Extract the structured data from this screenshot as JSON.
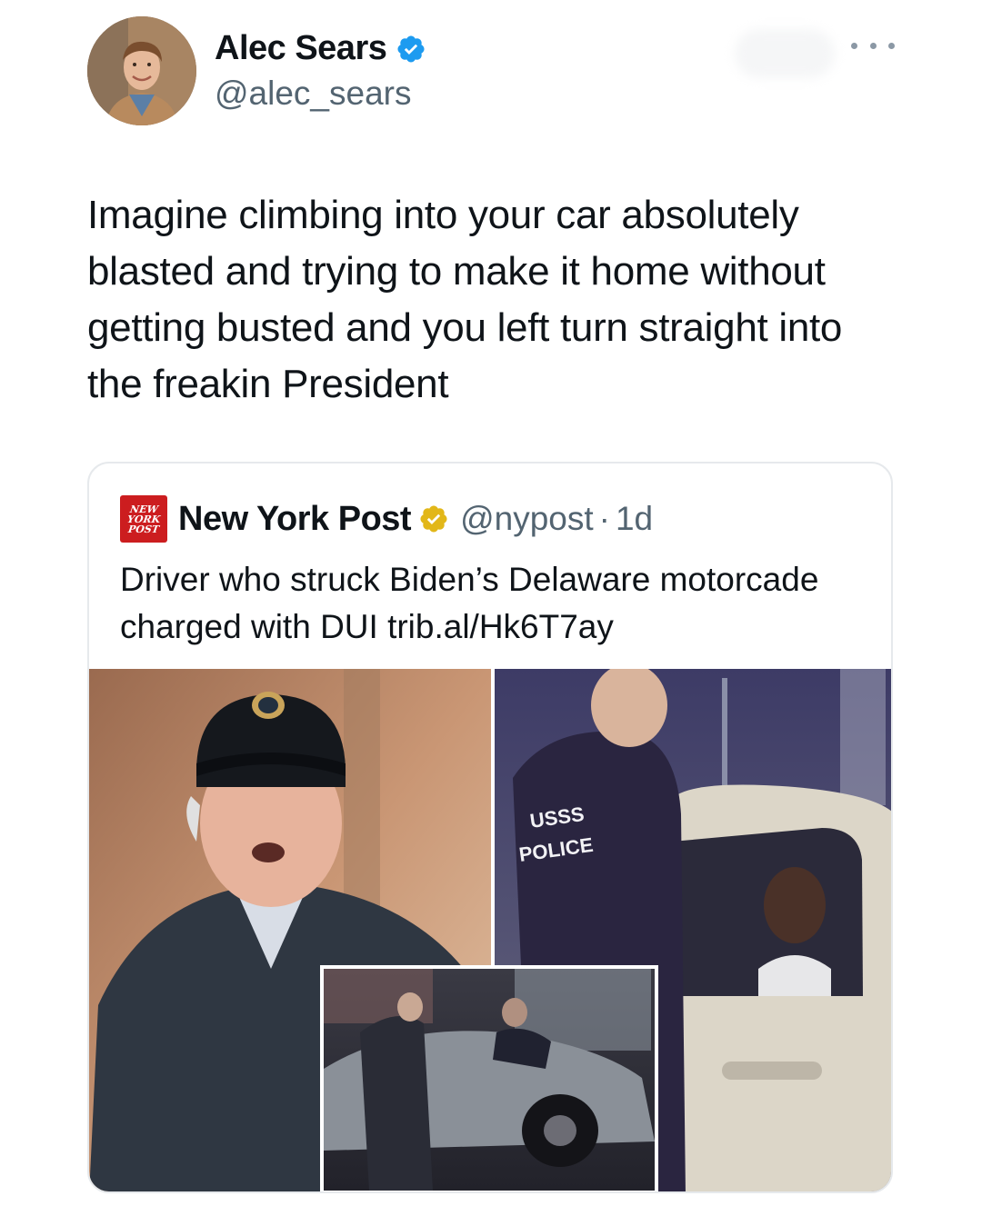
{
  "author": {
    "display_name": "Alec Sears",
    "handle": "@alec_sears",
    "verified_icon": "blue-verified-badge",
    "avatar_icon": "profile-photo"
  },
  "more_icon": "more-horizontal-icon",
  "tweet": {
    "text": "Imagine climbing into your car absolutely blasted and trying to make it home without getting busted and you left turn straight into the freakin President"
  },
  "quote": {
    "logo_lines": [
      "NEW",
      "YORK",
      "POST"
    ],
    "display_name": "New York Post",
    "verified_icon": "gold-verified-badge",
    "handle": "@nypost",
    "separator": "·",
    "time": "1d",
    "text": "Driver who struck Biden’s Delaware motorcade charged with DUI trib.al/Hk6T7ay",
    "photo_jacket_text": [
      "USSS",
      "POLICE"
    ]
  },
  "colors": {
    "verified_blue": "#1d9bf0",
    "verified_gold": "#e2b719",
    "nypost_red": "#cc1d1f",
    "secondary_text": "#536471"
  }
}
